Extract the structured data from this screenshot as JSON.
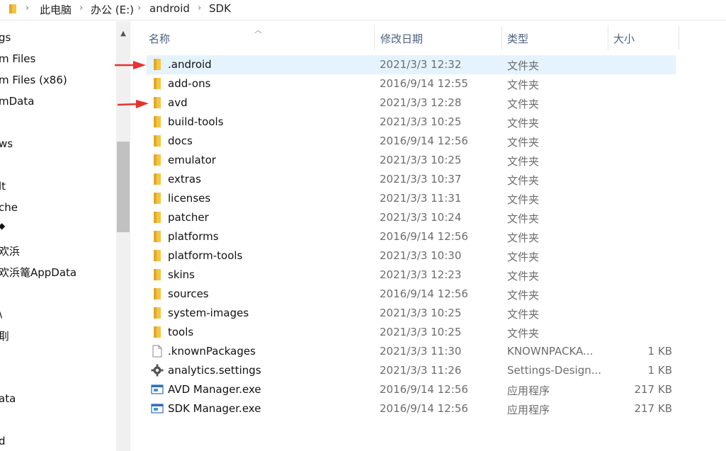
{
  "breadcrumb": {
    "items": [
      "此电脑",
      "办公 (E:)",
      "android",
      "SDK"
    ]
  },
  "nav": {
    "items": [
      "gs",
      "m Files",
      "m Files (x86)",
      "mData",
      "ws",
      "lt",
      "che",
      "◆",
      "欢浜",
      "欢浜篭AppData",
      "\\",
      "刵",
      "ata",
      "d"
    ]
  },
  "columns": {
    "name": "名称",
    "date": "修改日期",
    "type": "类型",
    "size": "大小"
  },
  "rows": [
    {
      "name": ".android",
      "date": "2021/3/3 12:32",
      "type": "文件夹",
      "size": "",
      "icon": "folder-icon",
      "selected": true
    },
    {
      "name": "add-ons",
      "date": "2016/9/14 12:55",
      "type": "文件夹",
      "size": "",
      "icon": "folder-icon"
    },
    {
      "name": "avd",
      "date": "2021/3/3 12:28",
      "type": "文件夹",
      "size": "",
      "icon": "folder-icon"
    },
    {
      "name": "build-tools",
      "date": "2021/3/3 10:25",
      "type": "文件夹",
      "size": "",
      "icon": "folder-icon"
    },
    {
      "name": "docs",
      "date": "2016/9/14 12:56",
      "type": "文件夹",
      "size": "",
      "icon": "folder-icon"
    },
    {
      "name": "emulator",
      "date": "2021/3/3 10:25",
      "type": "文件夹",
      "size": "",
      "icon": "folder-icon"
    },
    {
      "name": "extras",
      "date": "2021/3/3 10:37",
      "type": "文件夹",
      "size": "",
      "icon": "folder-icon"
    },
    {
      "name": "licenses",
      "date": "2021/3/3 11:31",
      "type": "文件夹",
      "size": "",
      "icon": "folder-icon"
    },
    {
      "name": "patcher",
      "date": "2021/3/3 10:24",
      "type": "文件夹",
      "size": "",
      "icon": "folder-icon"
    },
    {
      "name": "platforms",
      "date": "2016/9/14 12:56",
      "type": "文件夹",
      "size": "",
      "icon": "folder-icon"
    },
    {
      "name": "platform-tools",
      "date": "2021/3/3 10:30",
      "type": "文件夹",
      "size": "",
      "icon": "folder-icon"
    },
    {
      "name": "skins",
      "date": "2021/3/3 12:23",
      "type": "文件夹",
      "size": "",
      "icon": "folder-icon"
    },
    {
      "name": "sources",
      "date": "2016/9/14 12:56",
      "type": "文件夹",
      "size": "",
      "icon": "folder-icon"
    },
    {
      "name": "system-images",
      "date": "2021/3/3 10:25",
      "type": "文件夹",
      "size": "",
      "icon": "folder-icon"
    },
    {
      "name": "tools",
      "date": "2021/3/3 10:25",
      "type": "文件夹",
      "size": "",
      "icon": "folder-icon"
    },
    {
      "name": ".knownPackages",
      "date": "2021/3/3 11:30",
      "type": "KNOWNPACKA...",
      "size": "1 KB",
      "icon": "file-icon"
    },
    {
      "name": "analytics.settings",
      "date": "2021/3/3 11:26",
      "type": "Settings-Design...",
      "size": "1 KB",
      "icon": "gear-icon"
    },
    {
      "name": "AVD Manager.exe",
      "date": "2016/9/14 12:56",
      "type": "应用程序",
      "size": "217 KB",
      "icon": "app-icon"
    },
    {
      "name": "SDK Manager.exe",
      "date": "2016/9/14 12:56",
      "type": "应用程序",
      "size": "217 KB",
      "icon": "app-icon"
    }
  ],
  "colors": {
    "selection": "#e5f3ff",
    "annotation_arrow": "#e8322b",
    "folder": "#f5c542"
  }
}
